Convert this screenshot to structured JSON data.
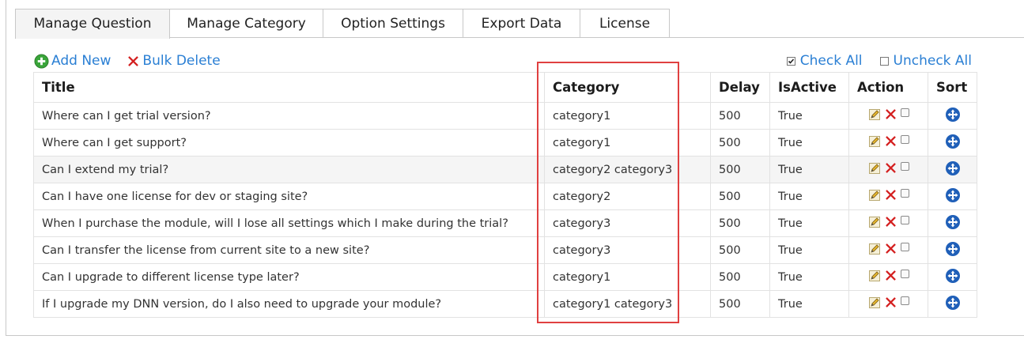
{
  "tabs": [
    {
      "label": "Manage Question",
      "active": true
    },
    {
      "label": "Manage Category",
      "active": false
    },
    {
      "label": "Option Settings",
      "active": false
    },
    {
      "label": "Export Data",
      "active": false
    },
    {
      "label": "License",
      "active": false
    }
  ],
  "toolbar": {
    "add_new_label": "Add New",
    "bulk_delete_label": "Bulk Delete",
    "check_all_label": "Check All",
    "uncheck_all_label": "Uncheck All"
  },
  "table": {
    "columns": [
      "Title",
      "Category",
      "Delay",
      "IsActive",
      "Action",
      "Sort"
    ],
    "rows": [
      {
        "title": "Where can I get trial version?",
        "category": "category1",
        "delay": "500",
        "active": "True"
      },
      {
        "title": "Where can I get support?",
        "category": "category1",
        "delay": "500",
        "active": "True"
      },
      {
        "title": "Can I extend my trial?",
        "category": "category2 category3",
        "delay": "500",
        "active": "True"
      },
      {
        "title": "Can I have one license for dev or staging site?",
        "category": "category2",
        "delay": "500",
        "active": "True"
      },
      {
        "title": "When I purchase the module, will I lose all settings which I make during the trial?",
        "category": "category3",
        "delay": "500",
        "active": "True"
      },
      {
        "title": "Can I transfer the license from current site to a new site?",
        "category": "category3",
        "delay": "500",
        "active": "True"
      },
      {
        "title": "Can I upgrade to different license type later?",
        "category": "category1",
        "delay": "500",
        "active": "True"
      },
      {
        "title": "If I upgrade my DNN version, do I also need to upgrade your module?",
        "category": "category1 category3",
        "delay": "500",
        "active": "True"
      }
    ]
  },
  "icons": {
    "add": "plus-circle-icon",
    "bulk_delete": "red-x-icon",
    "edit": "pencil-icon",
    "delete": "red-x-icon",
    "sort": "move-arrows-icon"
  },
  "colors": {
    "link": "#2a7fd4",
    "delete": "#d42020",
    "add": "#3aa53a",
    "sort": "#1f5fb8",
    "highlight": "#e04040"
  }
}
